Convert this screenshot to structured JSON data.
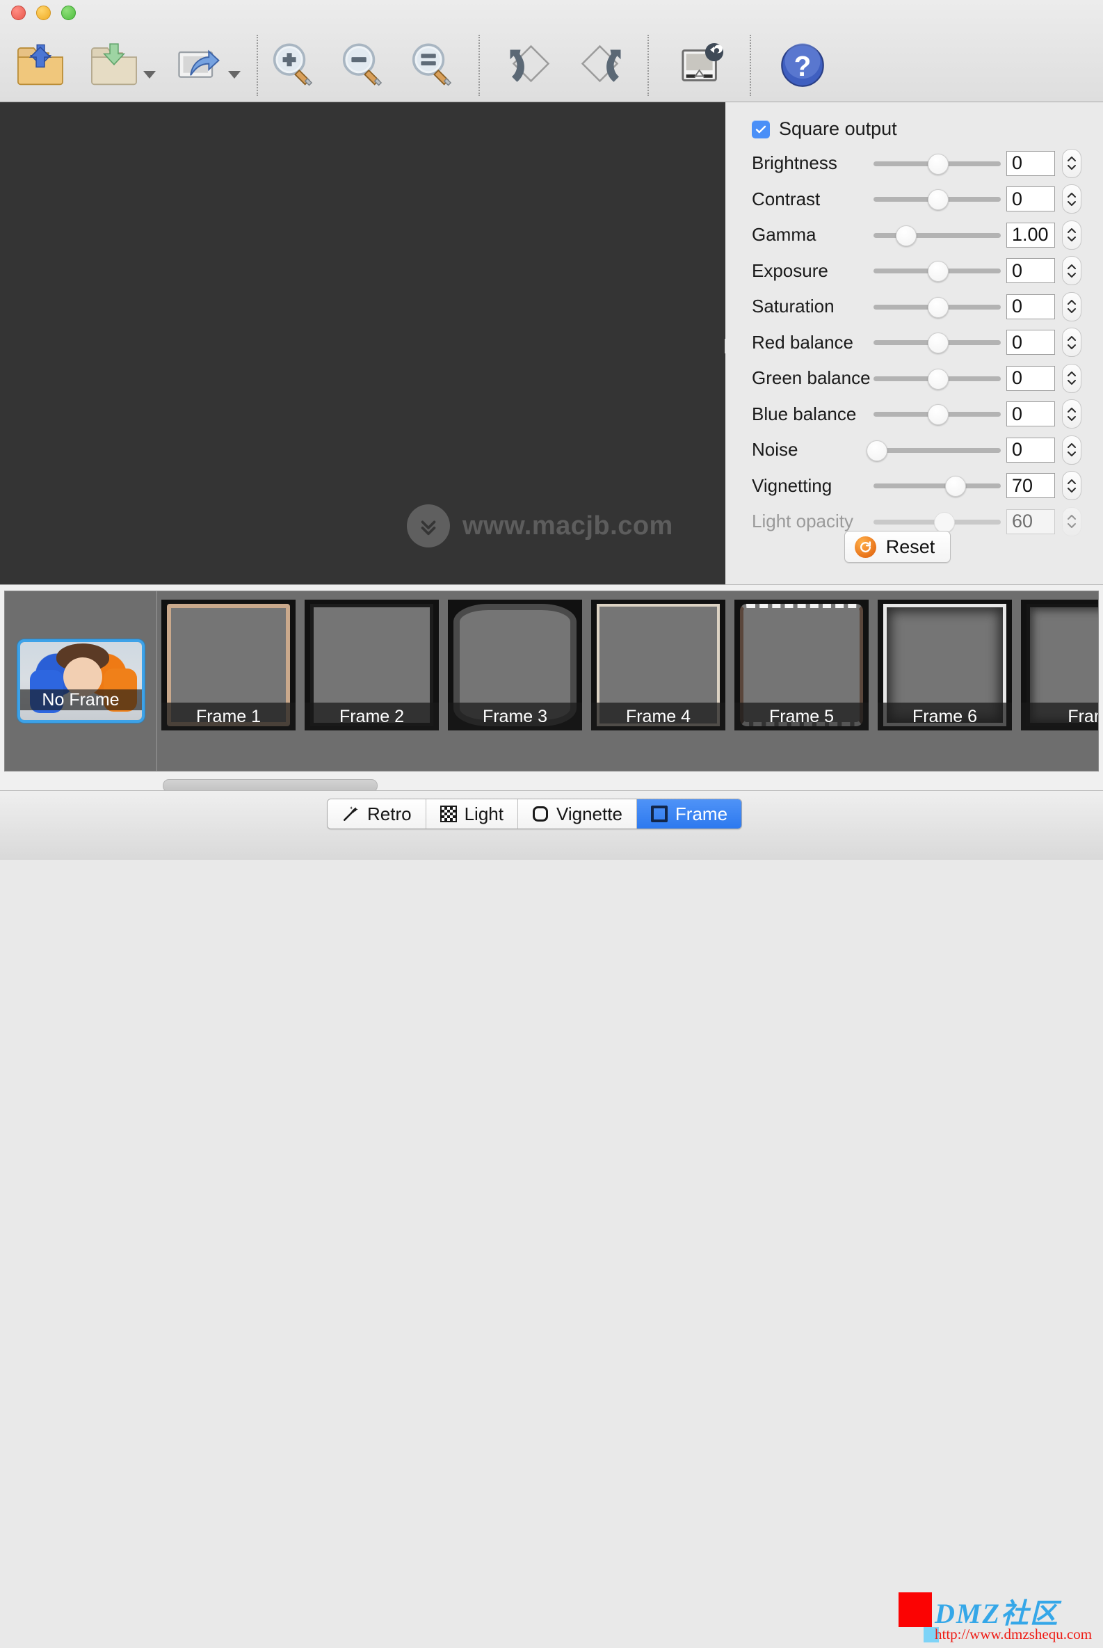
{
  "window": {
    "traffic_lights": [
      "close",
      "minimize",
      "zoom"
    ]
  },
  "toolbar": {
    "items": [
      {
        "name": "open-icon",
        "label": "Open",
        "glyph": "folder-up-arrow",
        "has_dropdown": false
      },
      {
        "name": "save-icon",
        "label": "Save",
        "glyph": "folder-down-arrow",
        "has_dropdown": true
      },
      {
        "name": "share-icon",
        "label": "Share",
        "glyph": "image-share-arrow",
        "has_dropdown": true
      },
      {
        "name": "zoom-in-icon",
        "label": "Zoom In",
        "glyph": "magnifier-plus",
        "has_dropdown": false
      },
      {
        "name": "zoom-out-icon",
        "label": "Zoom Out",
        "glyph": "magnifier-minus",
        "has_dropdown": false
      },
      {
        "name": "zoom-actual-icon",
        "label": "Actual Size",
        "glyph": "magnifier-equals",
        "has_dropdown": false
      },
      {
        "name": "rotate-left-icon",
        "label": "Rotate Left",
        "glyph": "rotate-ccw-diamond",
        "has_dropdown": false
      },
      {
        "name": "rotate-right-icon",
        "label": "Rotate Right",
        "glyph": "rotate-cw-diamond",
        "has_dropdown": false
      },
      {
        "name": "revert-icon",
        "label": "Revert",
        "glyph": "image-revert",
        "has_dropdown": false
      },
      {
        "name": "help-icon",
        "label": "Help",
        "glyph": "question-mark-circle",
        "has_dropdown": false
      }
    ]
  },
  "canvas": {
    "background_color": "#343434",
    "watermark_text": "www.macjb.com",
    "watermark_icon": "chevron-double-down-circle-icon"
  },
  "panel": {
    "square_output": {
      "label": "Square output",
      "checked": true
    },
    "controls": [
      {
        "label": "Brightness",
        "value": "0",
        "percent": 50,
        "disabled": false
      },
      {
        "label": "Contrast",
        "value": "0",
        "percent": 50,
        "disabled": false
      },
      {
        "label": "Gamma",
        "value": "1.00",
        "percent": 25,
        "disabled": false
      },
      {
        "label": "Exposure",
        "value": "0",
        "percent": 50,
        "disabled": false
      },
      {
        "label": "Saturation",
        "value": "0",
        "percent": 50,
        "disabled": false
      },
      {
        "label": "Red balance",
        "value": "0",
        "percent": 50,
        "disabled": false
      },
      {
        "label": "Green balance",
        "value": "0",
        "percent": 50,
        "disabled": false
      },
      {
        "label": "Blue balance",
        "value": "0",
        "percent": 50,
        "disabled": false
      },
      {
        "label": "Noise",
        "value": "0",
        "percent": 2,
        "disabled": false
      },
      {
        "label": "Vignetting",
        "value": "70",
        "percent": 64,
        "disabled": false
      },
      {
        "label": "Light opacity",
        "value": "60",
        "percent": 55,
        "disabled": true
      }
    ],
    "reset_label": "Reset",
    "reset_icon": "reset-circular-arrow-icon"
  },
  "filmstrip": {
    "no_frame": {
      "label": "No Frame",
      "selected": true
    },
    "frames": [
      {
        "label": "Frame 1"
      },
      {
        "label": "Frame 2"
      },
      {
        "label": "Frame 3"
      },
      {
        "label": "Frame 4"
      },
      {
        "label": "Frame 5"
      },
      {
        "label": "Frame 6"
      },
      {
        "label": "Fram"
      }
    ]
  },
  "bottom_tabs": [
    {
      "label": "Retro",
      "icon": "magic-wand-icon",
      "active": false
    },
    {
      "label": "Light",
      "icon": "checker-grid-icon",
      "active": false
    },
    {
      "label": "Vignette",
      "icon": "rounded-square-outline-icon",
      "active": false
    },
    {
      "label": "Frame",
      "icon": "thick-square-outline-icon",
      "active": true
    }
  ],
  "branding": {
    "title": "DMZ社区",
    "url": "http://www.dmzshequ.com",
    "accent_red": "#fb0303",
    "accent_blue": "#35a7e8"
  }
}
